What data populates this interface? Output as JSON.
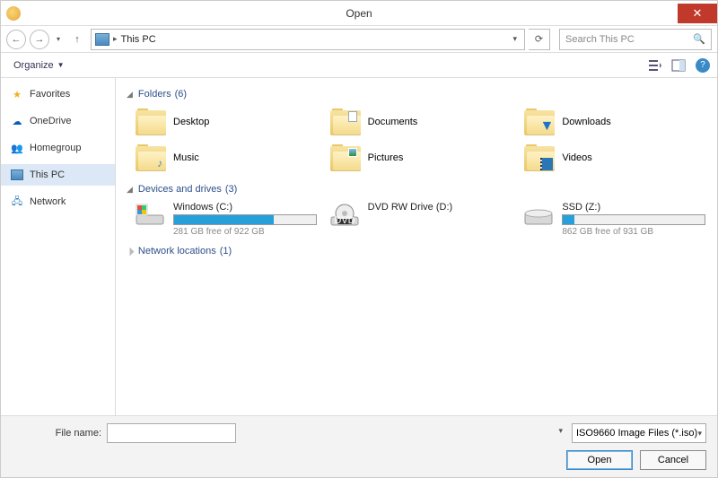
{
  "window": {
    "title": "Open"
  },
  "nav": {
    "location": "This PC",
    "search_placeholder": "Search This PC"
  },
  "toolbar": {
    "organize": "Organize"
  },
  "sidebar": {
    "items": [
      {
        "label": "Favorites"
      },
      {
        "label": "OneDrive"
      },
      {
        "label": "Homegroup"
      },
      {
        "label": "This PC"
      },
      {
        "label": "Network"
      }
    ]
  },
  "groups": {
    "folders": {
      "label": "Folders",
      "count": "(6)"
    },
    "drives": {
      "label": "Devices and drives",
      "count": "(3)"
    },
    "network": {
      "label": "Network locations",
      "count": "(1)"
    }
  },
  "folders": [
    {
      "name": "Desktop"
    },
    {
      "name": "Documents"
    },
    {
      "name": "Downloads"
    },
    {
      "name": "Music"
    },
    {
      "name": "Pictures"
    },
    {
      "name": "Videos"
    }
  ],
  "drives": [
    {
      "name": "Windows (C:)",
      "free": "281 GB free of 922 GB",
      "fill_pct": 70
    },
    {
      "name": "DVD RW Drive (D:)",
      "free": "",
      "fill_pct": null
    },
    {
      "name": "SSD (Z:)",
      "free": "862 GB free of 931 GB",
      "fill_pct": 8
    }
  ],
  "footer": {
    "filename_label": "File name:",
    "filetype": "ISO9660 Image Files (*.iso)",
    "open": "Open",
    "cancel": "Cancel"
  }
}
